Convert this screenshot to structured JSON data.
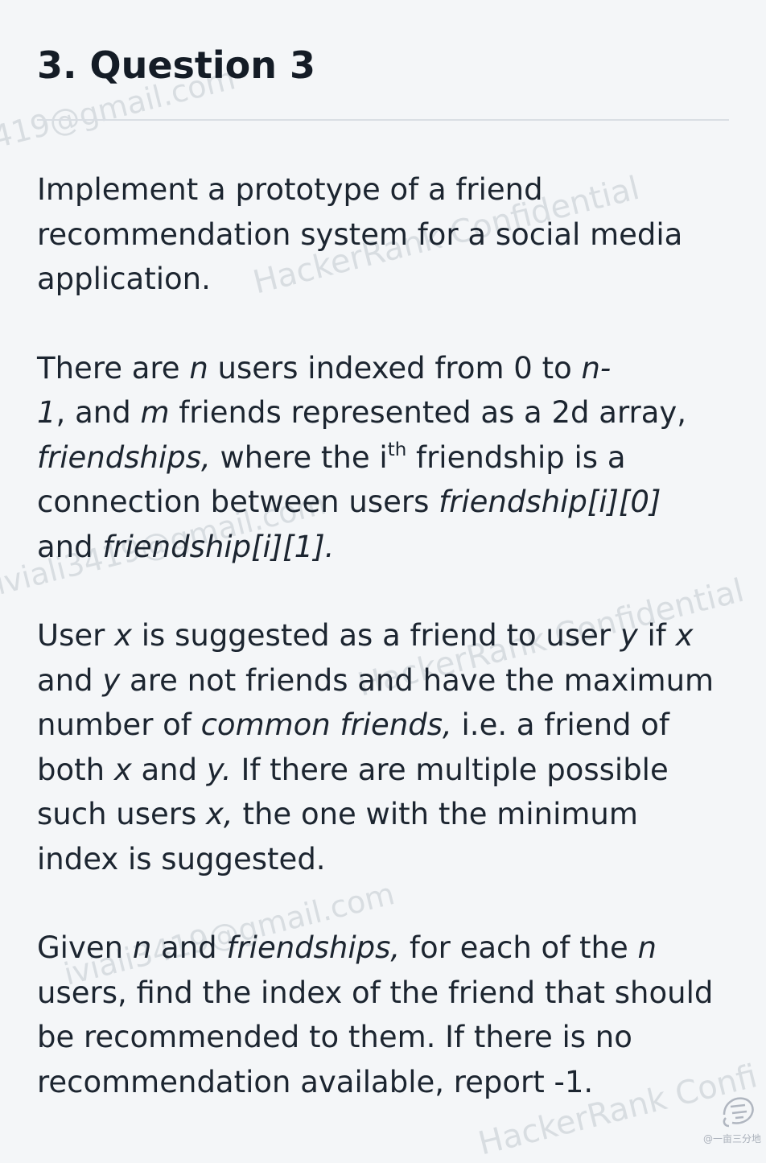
{
  "question_title": "3. Question 3",
  "paragraphs": {
    "p1": {
      "s1": "Implement a prototype of a friend recommendation system for a social media application."
    },
    "p2": {
      "s1": "There are ",
      "n": "n",
      "s2": " users indexed from 0 to ",
      "n_minus": "n-",
      "one": "1",
      "s3": ", and ",
      "m": "m",
      "s4": " friends represented as a 2d array, ",
      "friendships": "friendships,",
      "s5": " where the i",
      "th": "th",
      "s6": " friendship is a connection between users ",
      "fi0": "friendship[i][0]",
      "s7": " and ",
      "fi1": "friendship[i][1]."
    },
    "p3": {
      "s1": "User ",
      "x": "x",
      "s2": " is suggested as a friend to user ",
      "y": "y",
      "s3": " if ",
      "x2": "x",
      "s4": " and ",
      "y2": "y",
      "s5": " are not friends and have the maximum number of ",
      "common": "common friends,",
      "s6": " i.e. a friend of both ",
      "x3": "x",
      "s7": " and ",
      "y3": "y.",
      "s8": " If there are multiple possible such users ",
      "x4": "x,",
      "s9": " the one with the minimum index is suggested."
    },
    "p4": {
      "s1": "Given ",
      "n": "n",
      "s2": " and ",
      "friendships": "friendships,",
      "s3": " for each of the ",
      "n2": "n",
      "s4": " users, find the index of the friend that should be recommended to them. If there is no recommendation available, report -1."
    }
  },
  "watermarks": {
    "w1": "419@gmail.com",
    "w2": "HackerRank Confidential",
    "w3": "iviali3419@gmail.com",
    "w4": "HackerRank Confidential",
    "w5": "iviali3419@gmail.com",
    "w6": "HackerRank Confi"
  },
  "corner_caption": "@一亩三分地",
  "icons": {
    "corner_logo": "brand-logo-icon"
  },
  "colors": {
    "background": "#f4f6f8",
    "text": "#1c2530",
    "divider": "#d9dee4",
    "watermark": "#788291"
  }
}
